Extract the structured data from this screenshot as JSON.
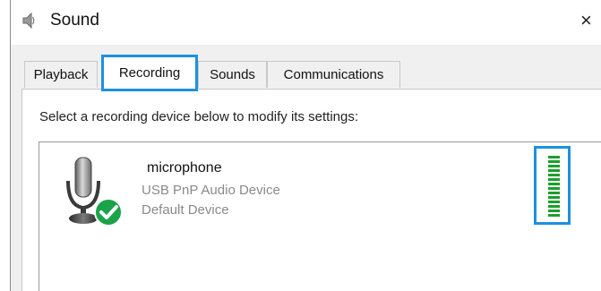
{
  "window": {
    "title": "Sound",
    "close_glyph": "×"
  },
  "tabs": [
    {
      "label": "Playback",
      "selected": false
    },
    {
      "label": "Recording",
      "selected": true
    },
    {
      "label": "Sounds",
      "selected": false
    },
    {
      "label": "Communications",
      "selected": false
    }
  ],
  "recording": {
    "instruction": "Select a recording device below to modify its settings:",
    "devices": [
      {
        "name": "microphone",
        "description": "USB PnP Audio Device",
        "status": "Default Device",
        "icon": "microphone-icon",
        "badge": "default-check-icon",
        "level": 1.0
      }
    ]
  },
  "colors": {
    "highlight": "#1e90e0",
    "level_green": "#1e9e2e",
    "check_green": "#1aa34a"
  }
}
